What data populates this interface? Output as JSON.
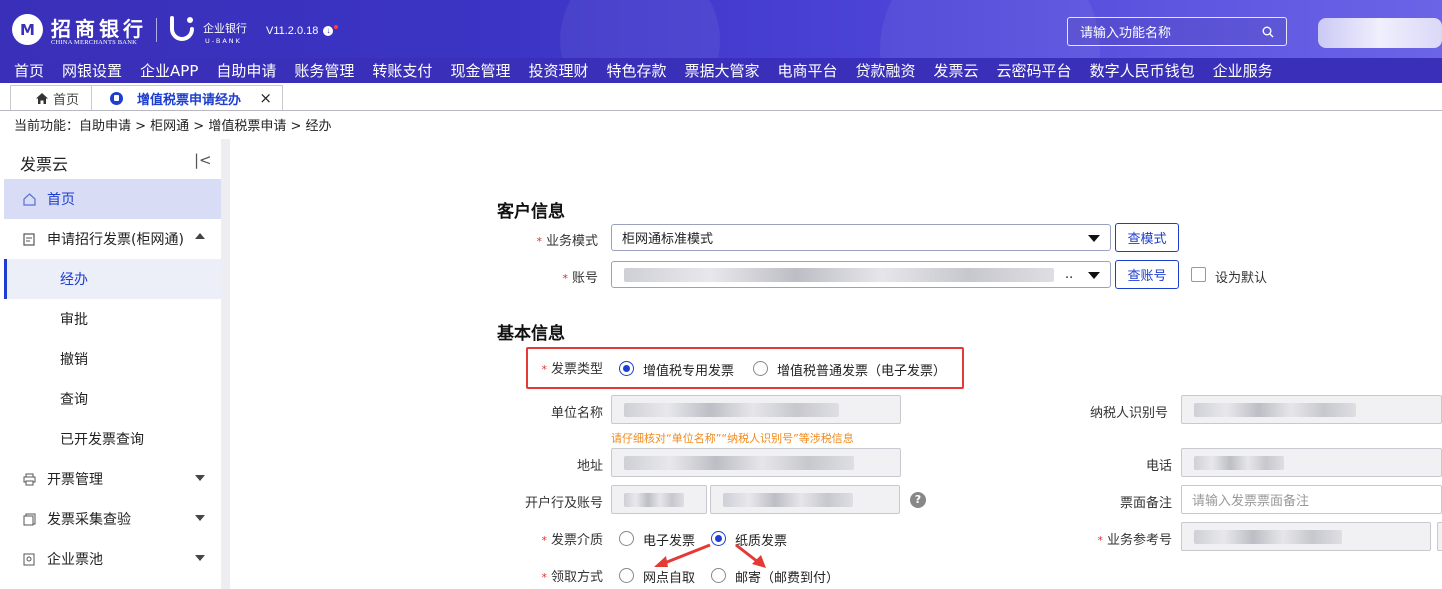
{
  "app": {
    "bank_name": "招商银行",
    "bank_name_en": "CHINA MERCHANTS BANK",
    "product_name": "企业银行",
    "product_name_en": "U-BANK",
    "version": "V11.2.0.18",
    "search_placeholder": "请输入功能名称"
  },
  "mainnav": [
    "首页",
    "网银设置",
    "企业APP",
    "自助申请",
    "账务管理",
    "转账支付",
    "现金管理",
    "投资理财",
    "特色存款",
    "票据大管家",
    "电商平台",
    "贷款融资",
    "发票云",
    "云密码平台",
    "数字人民币钱包",
    "企业服务"
  ],
  "tabs": {
    "home": "首页",
    "active": "增值税票申请经办"
  },
  "breadcrumb": "当前功能：自助申请 > 柜网通 > 增值税票申请 > 经办",
  "sidebar": {
    "title": "发票云",
    "items": [
      {
        "label": "首页"
      },
      {
        "label": "申请招行发票(柜网通)"
      },
      {
        "label": "经办"
      },
      {
        "label": "审批"
      },
      {
        "label": "撤销"
      },
      {
        "label": "查询"
      },
      {
        "label": "已开发票查询"
      },
      {
        "label": "开票管理"
      },
      {
        "label": "发票采集查验"
      },
      {
        "label": "企业票池"
      }
    ]
  },
  "form": {
    "customer_section": "客户信息",
    "business_mode_label": "业务模式",
    "business_mode_value": "柜网通标准模式",
    "query_mode_button": "查模式",
    "account_label": "账号",
    "account_suffix": "..",
    "query_account_button": "查账号",
    "set_default_label": "设为默认",
    "basic_section": "基本信息",
    "invoice_type_label": "发票类型",
    "invoice_type_options": [
      "增值税专用发票",
      "增值税普通发票（电子发票）"
    ],
    "invoice_type_selected": "增值税专用发票",
    "company_name_label": "单位名称",
    "hint": "请仔细核对“单位名称”“纳税人识别号”等涉税信息",
    "taxpayer_id_label": "纳税人识别号",
    "address_label": "地址",
    "phone_label": "电话",
    "bank_account_label": "开户行及账号",
    "help_mark": "?",
    "remark_label": "票面备注",
    "remark_placeholder": "请输入发票票面备注",
    "medium_label": "发票介质",
    "medium_options": [
      "电子发票",
      "纸质发票"
    ],
    "medium_selected": "纸质发票",
    "ref_no_label": "业务参考号",
    "pickup_label": "领取方式",
    "pickup_options": [
      "网点自取",
      "邮寄（邮费到付）"
    ]
  },
  "colors": {
    "brand": "#3a2fb8",
    "accent": "#1d3ecf",
    "highlight": "#e53935",
    "hint": "#f08a1c"
  }
}
